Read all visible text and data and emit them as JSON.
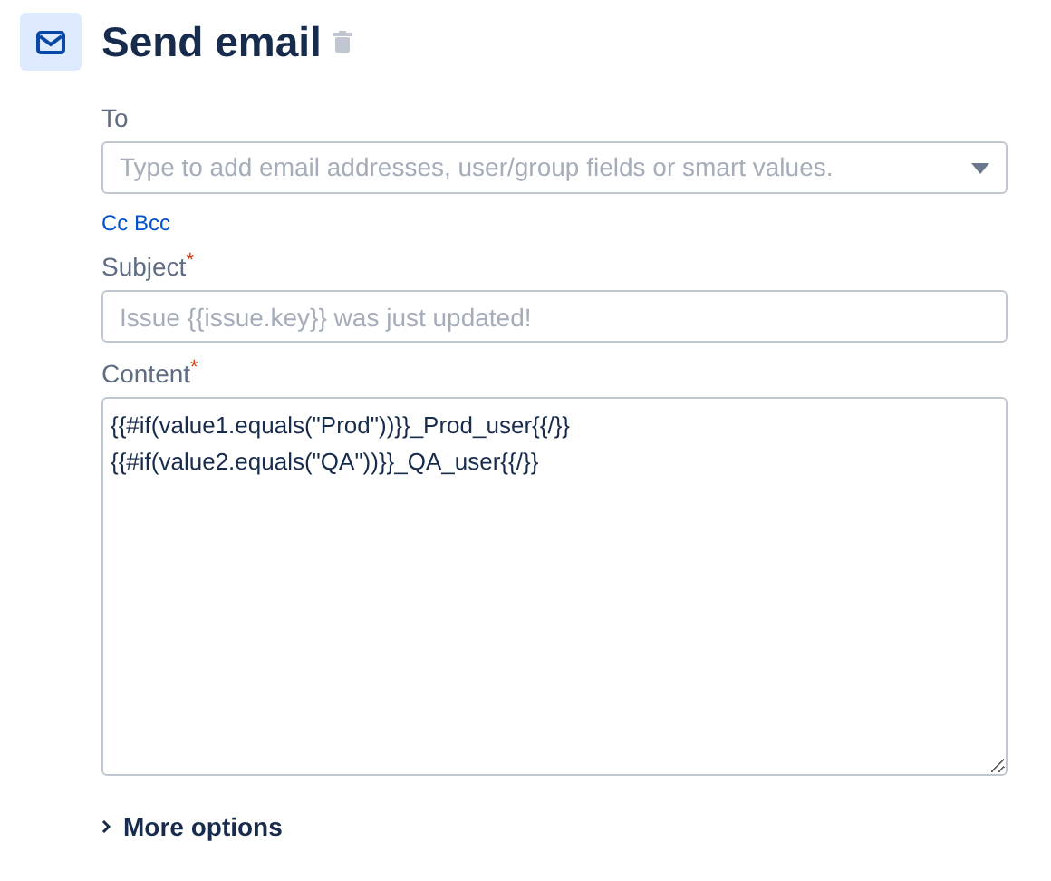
{
  "header": {
    "title": "Send email"
  },
  "to": {
    "label": "To",
    "placeholder": "Type to add email addresses, user/group fields or smart values."
  },
  "cc_bcc_link": "Cc Bcc",
  "subject": {
    "label": "Subject",
    "required_mark": "*",
    "placeholder": "Issue {{issue.key}} was just updated!"
  },
  "content": {
    "label": "Content",
    "required_mark": "*",
    "lines": [
      "{{#if(value1.equals(\"Prod\"))}}_Prod_user{{/}}",
      "{{#if(value2.equals(\"QA\"))}}_QA_user{{/}}"
    ]
  },
  "more_options": {
    "label": "More options",
    "expanded": false
  }
}
